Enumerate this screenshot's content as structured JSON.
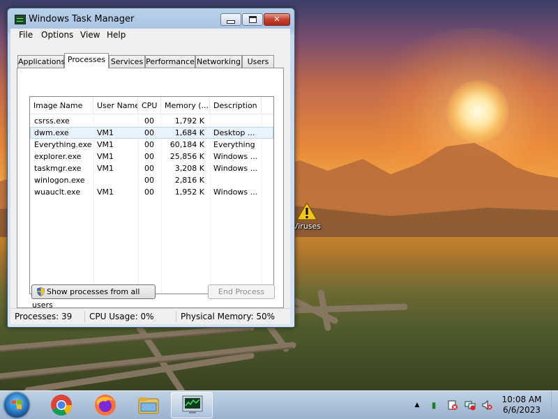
{
  "window": {
    "title": "Windows Task Manager",
    "close_label": "✕"
  },
  "menu": [
    "File",
    "Options",
    "View",
    "Help"
  ],
  "tabs": [
    "Applications",
    "Processes",
    "Services",
    "Performance",
    "Networking",
    "Users"
  ],
  "active_tab": "Processes",
  "columns": [
    "Image Name",
    "User Name",
    "CPU",
    "Memory (...",
    "Description"
  ],
  "processes": [
    {
      "image": "csrss.exe",
      "user": "",
      "cpu": "00",
      "memory": "1,792 K",
      "description": ""
    },
    {
      "image": "dwm.exe",
      "user": "VM1",
      "cpu": "00",
      "memory": "1,684 K",
      "description": "Desktop ..."
    },
    {
      "image": "Everything.exe",
      "user": "VM1",
      "cpu": "00",
      "memory": "60,184 K",
      "description": "Everything"
    },
    {
      "image": "explorer.exe",
      "user": "VM1",
      "cpu": "00",
      "memory": "25,856 K",
      "description": "Windows ..."
    },
    {
      "image": "taskmgr.exe",
      "user": "VM1",
      "cpu": "00",
      "memory": "3,208 K",
      "description": "Windows ..."
    },
    {
      "image": "winlogon.exe",
      "user": "",
      "cpu": "00",
      "memory": "2,816 K",
      "description": ""
    },
    {
      "image": "wuauclt.exe",
      "user": "VM1",
      "cpu": "00",
      "memory": "1,952 K",
      "description": "Windows ..."
    }
  ],
  "buttons": {
    "show_all": "Show processes from all users",
    "end_process": "End Process"
  },
  "status": {
    "processes": "Processes: 39",
    "cpu": "CPU Usage: 0%",
    "memory": "Physical Memory: 50%"
  },
  "desktop": {
    "icon_label": "Viruses"
  },
  "taskbar": {
    "pinned": [
      "chrome-icon",
      "firefox-icon",
      "file-explorer-icon",
      "task-manager-icon"
    ],
    "clock_time": "10:08 AM",
    "clock_date": "6/6/2023"
  },
  "colors": {
    "accent": "#3d5a7a",
    "hover_row": "#e8f3fd",
    "close_button": "#c4412d"
  }
}
